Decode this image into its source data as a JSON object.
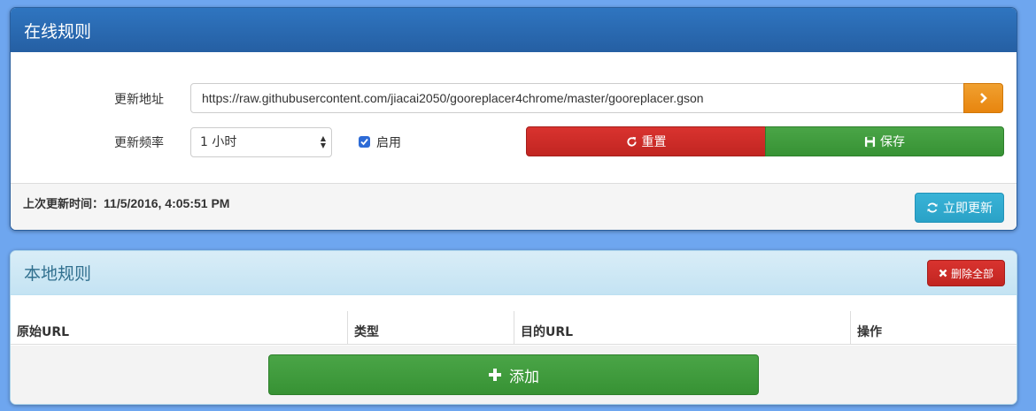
{
  "online": {
    "title": "在线规则",
    "url_label": "更新地址",
    "url_value": "https://raw.githubusercontent.com/jiacai2050/gooreplacer4chrome/master/gooreplacer.gson",
    "freq_label": "更新频率",
    "freq_value": "1 小时",
    "enable_label": "启用",
    "enable_checked": true,
    "reset_label": "重置",
    "save_label": "保存",
    "last_update_label": "上次更新时间：",
    "last_update_value": "11/5/2016, 4:05:51 PM",
    "update_now_label": "立即更新"
  },
  "local": {
    "title": "本地规则",
    "delete_all_label": "删除全部",
    "columns": [
      "原始URL",
      "类型",
      "目的URL",
      "操作"
    ],
    "add_label": "添加"
  },
  "colors": {
    "background": "#6ea6ef",
    "primary_header": "#2a6ab3",
    "info_header": "#d9edf7",
    "danger": "#c9302c",
    "success": "#449d44",
    "warning": "#ec971f",
    "info": "#31b0d5"
  },
  "icons": {
    "go": "chevron-right-icon",
    "reset": "refresh-icon",
    "save": "floppy-disk-icon",
    "update": "sync-icon",
    "delete_all": "close-icon",
    "add": "plus-icon"
  }
}
